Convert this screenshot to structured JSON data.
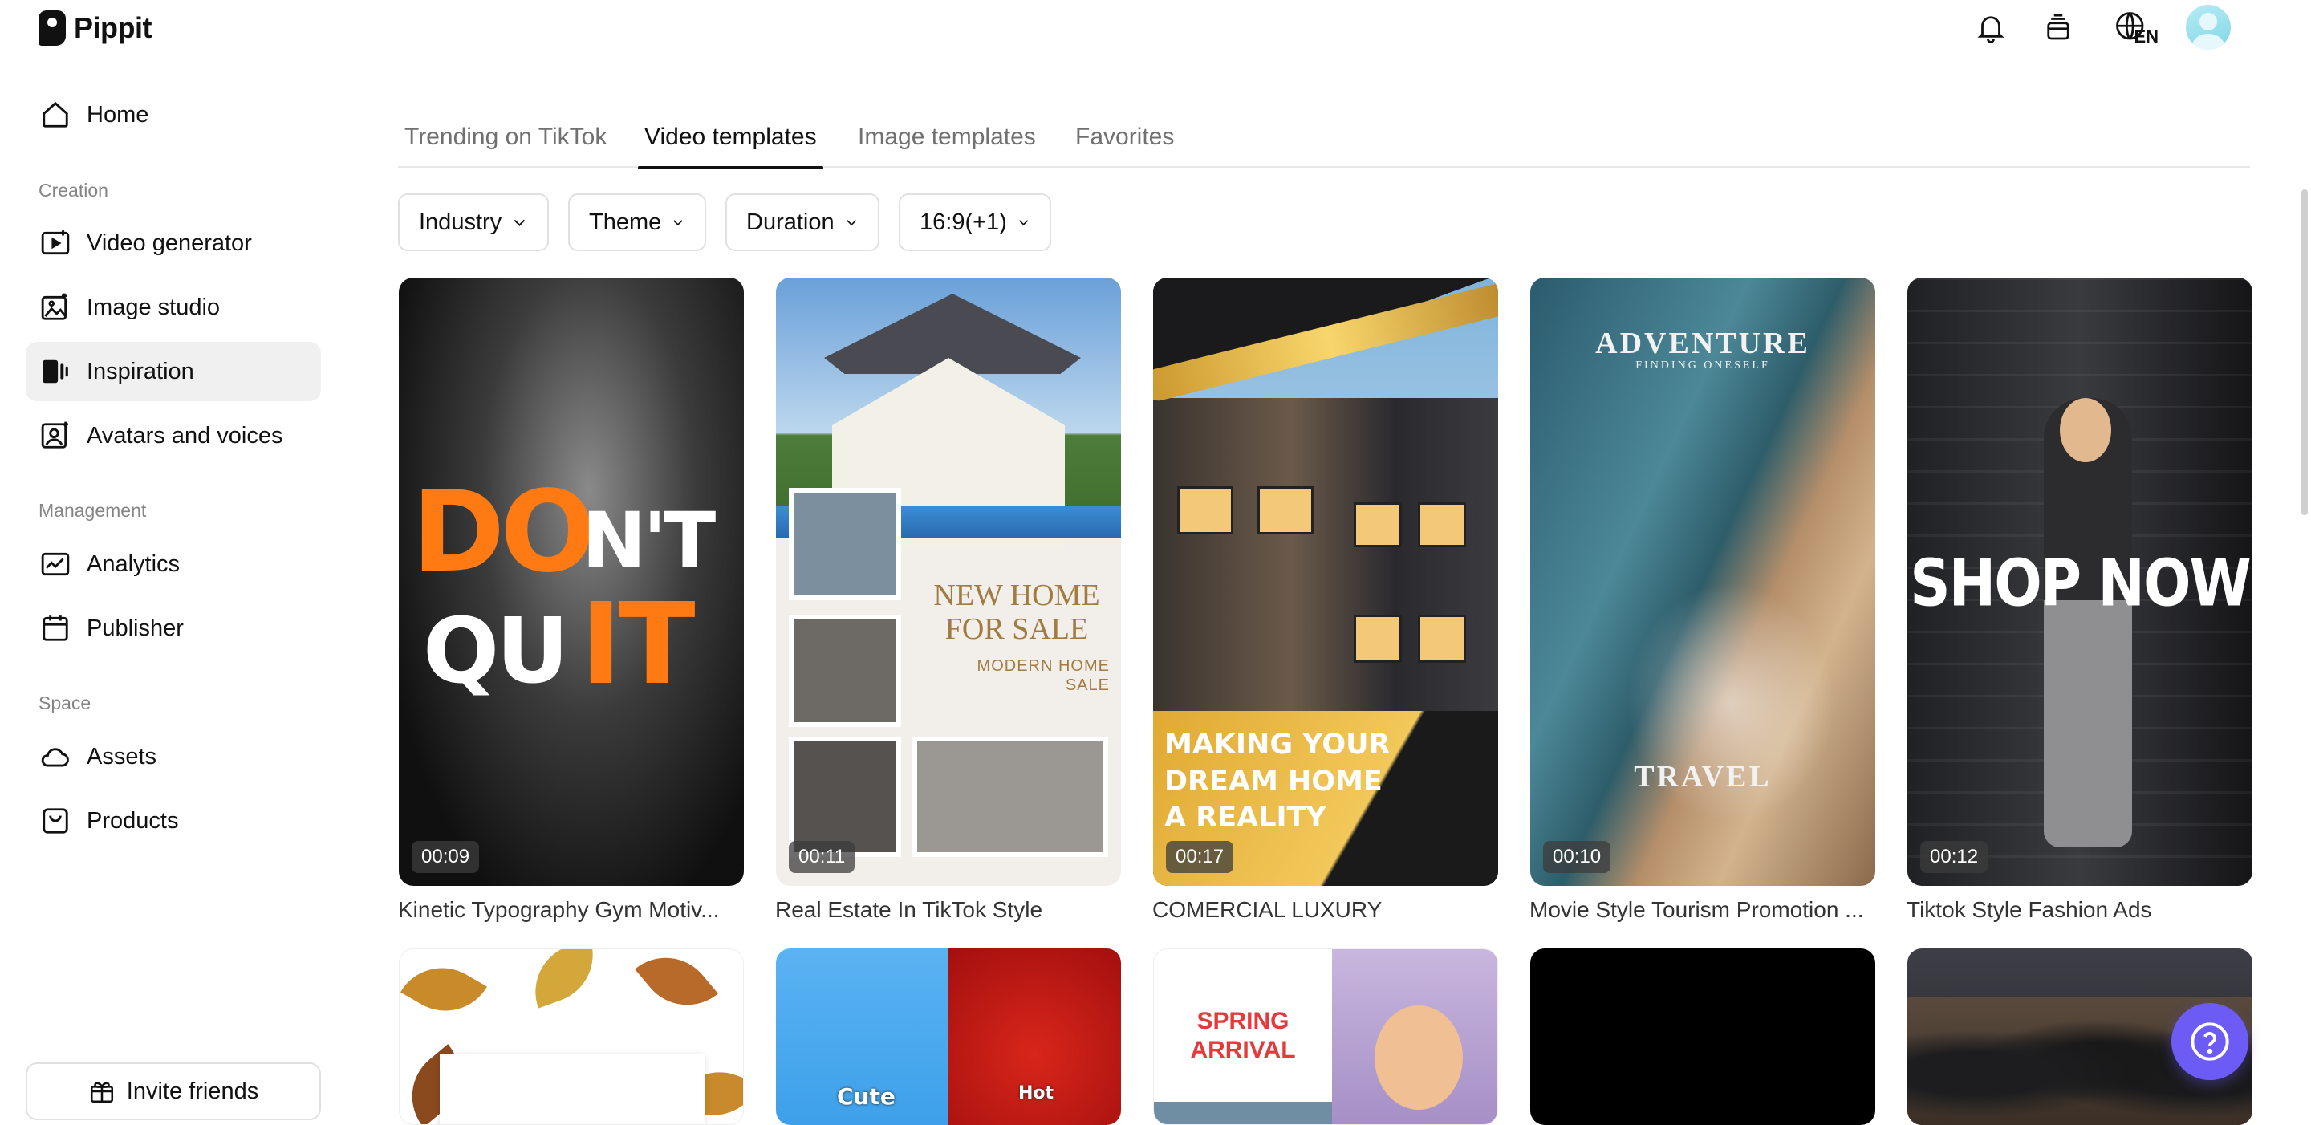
{
  "app": {
    "name": "Pippit",
    "language": "EN"
  },
  "header": {
    "icons": [
      "bell-icon",
      "layers-icon",
      "globe-icon",
      "user-avatar"
    ]
  },
  "sidebar": {
    "items": [
      {
        "label": "Home",
        "icon": "home-icon"
      },
      {
        "label": "Video generator",
        "icon": "video-plus-icon"
      },
      {
        "label": "Image studio",
        "icon": "image-edit-icon"
      },
      {
        "label": "Inspiration",
        "icon": "inspiration-icon",
        "active": true
      },
      {
        "label": "Avatars and voices",
        "icon": "avatar-icon"
      },
      {
        "label": "Analytics",
        "icon": "analytics-icon"
      },
      {
        "label": "Publisher",
        "icon": "calendar-icon"
      },
      {
        "label": "Assets",
        "icon": "cloud-icon"
      },
      {
        "label": "Products",
        "icon": "bag-icon"
      }
    ],
    "sections": {
      "creation": "Creation",
      "management": "Management",
      "space": "Space"
    },
    "invite_label": "Invite friends"
  },
  "tabs": [
    {
      "label": "Trending on TikTok"
    },
    {
      "label": "Video templates",
      "active": true
    },
    {
      "label": "Image templates"
    },
    {
      "label": "Favorites"
    }
  ],
  "filters": [
    {
      "label": "Industry"
    },
    {
      "label": "Theme"
    },
    {
      "label": "Duration"
    },
    {
      "label": "16:9(+1)"
    }
  ],
  "cards": [
    {
      "title": "Kinetic Typography Gym Motiv...",
      "duration": "00:09",
      "overlay": {
        "a": "DO",
        "b": "N'T",
        "c": "QU",
        "d": "IT"
      }
    },
    {
      "title": "Real Estate In TikTok Style",
      "duration": "00:11",
      "overlay": {
        "headline": "NEW HOME FOR SALE",
        "sub": "MODERN HOME SALE"
      }
    },
    {
      "title": "COMERCIAL LUXURY",
      "duration": "00:17",
      "overlay": {
        "headline": "MAKING YOUR DREAM HOME A REALITY"
      }
    },
    {
      "title": "Movie Style Tourism Promotion ...",
      "duration": "00:10",
      "overlay": {
        "top": "ADVENTURE",
        "top_sub": "FINDING ONESELF",
        "bottom": "TRAVEL"
      }
    },
    {
      "title": "Tiktok Style Fashion Ads",
      "duration": "00:12",
      "overlay": {
        "headline": "SHOP NOW"
      }
    }
  ],
  "cards_row2": [
    {
      "theme": "autumn leaves"
    },
    {
      "left": "Cute",
      "right": "Hot"
    },
    {
      "headline": "SPRING ARRIVAL"
    },
    {
      "theme": "black"
    },
    {
      "theme": "crowd"
    }
  ],
  "colors": {
    "accent": "#6c5cf5",
    "orange": "#ff7a12",
    "gold": "#e0a932"
  }
}
